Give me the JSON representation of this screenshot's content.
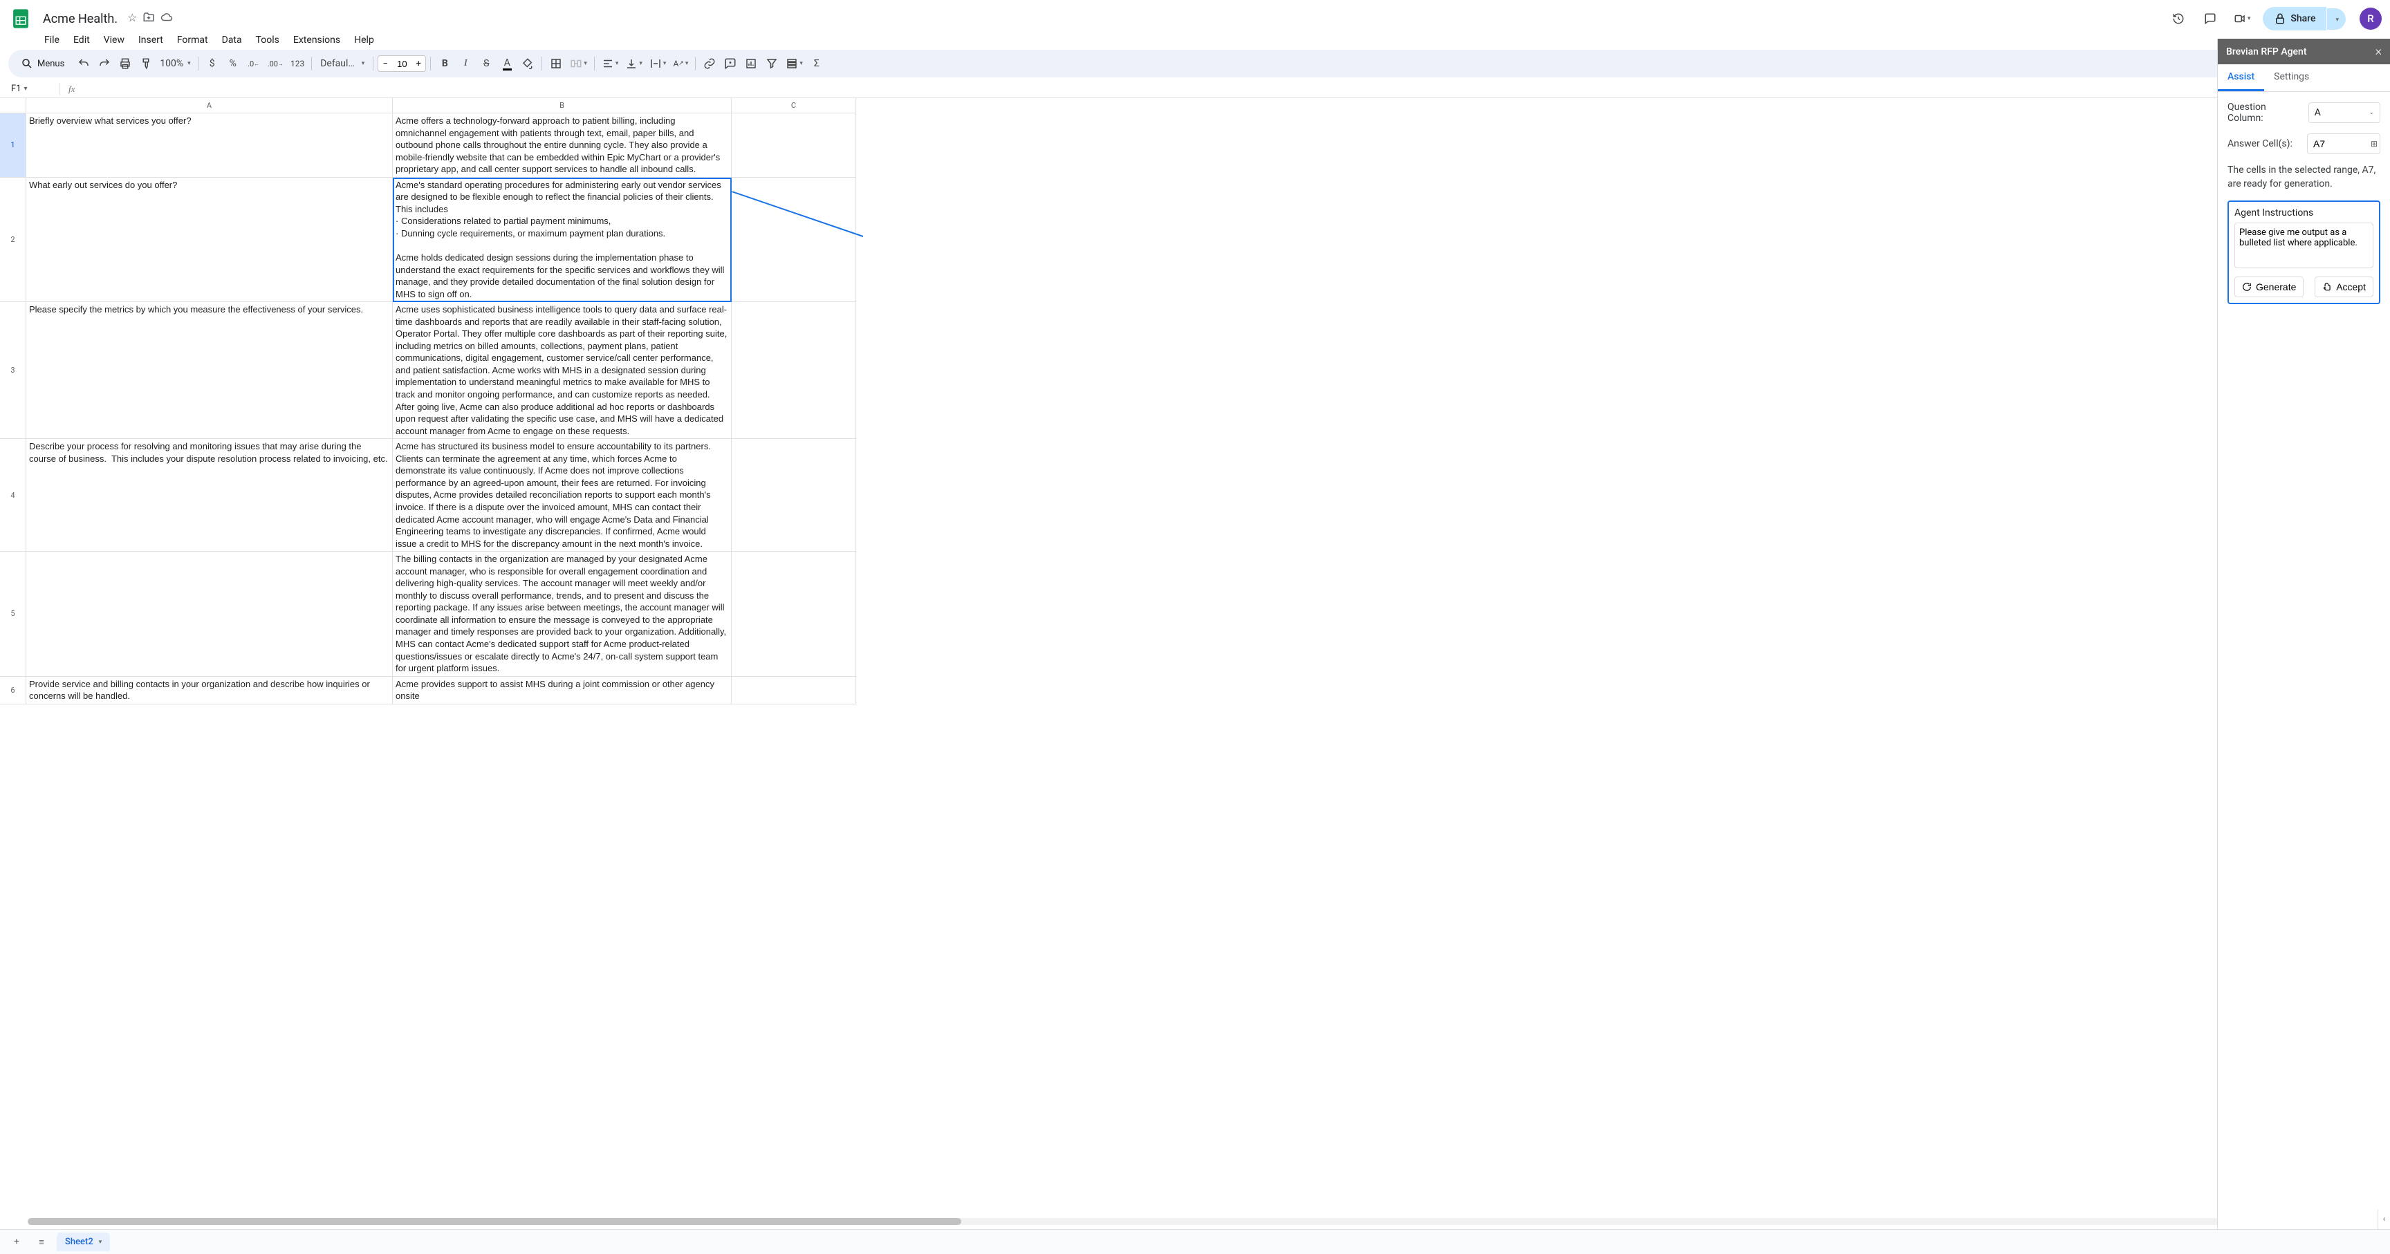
{
  "doc": {
    "title": "Acme Health."
  },
  "menu": [
    "File",
    "Edit",
    "View",
    "Insert",
    "Format",
    "Data",
    "Tools",
    "Extensions",
    "Help"
  ],
  "toolbar": {
    "search_label": "Menus",
    "zoom": "100%",
    "currency": "$",
    "percent": "%",
    "number_fmt": "123",
    "font": "Defaul…",
    "font_size": "10"
  },
  "namebox": "F1",
  "share_label": "Share",
  "avatar_letter": "R",
  "columns": [
    "A",
    "B",
    "C"
  ],
  "rows": [
    {
      "n": "1",
      "a": "Briefly overview what services you offer?",
      "b": "Acme offers a technology-forward approach to patient billing, including omnichannel engagement with patients through text, email, paper bills, and outbound phone calls throughout the entire dunning cycle. They also provide a mobile-friendly website that can be embedded within Epic MyChart or a provider's proprietary app, and call center support services to handle all inbound calls.",
      "c": ""
    },
    {
      "n": "2",
      "a": "What early out services do you offer?",
      "b": "Acme's standard operating procedures for administering early out vendor services are designed to be flexible enough to reflect the financial policies of their clients. This includes\n· Considerations related to partial payment minimums,\n· Dunning cycle requirements, or maximum payment plan durations.\n\nAcme holds dedicated design sessions during the implementation phase to understand the exact requirements for the specific services and workflows they will manage, and they provide detailed documentation of the final solution design for MHS to sign off on.",
      "c": ""
    },
    {
      "n": "3",
      "a": "Please specify the metrics by which you measure the effectiveness of your services.",
      "b": "Acme uses sophisticated business intelligence tools to query data and surface real-time dashboards and reports that are readily available in their staff-facing solution, Operator Portal. They offer multiple core dashboards as part of their reporting suite, including metrics on billed amounts, collections, payment plans, patient communications, digital engagement, customer service/call center performance, and patient satisfaction. Acme works with MHS in a designated session during implementation to understand meaningful metrics to make available for MHS to track and monitor ongoing performance, and can customize reports as needed. After going live, Acme can also produce additional ad hoc reports or dashboards upon request after validating the specific use case, and MHS will have a dedicated account manager from Acme to engage on these requests.",
      "c": ""
    },
    {
      "n": "4",
      "a": "Describe your process for resolving and monitoring issues that may arise during the course of business.  This includes your dispute resolution process related to invoicing, etc.",
      "b": "Acme has structured its business model to ensure accountability to its partners. Clients can terminate the agreement at any time, which forces Acme to demonstrate its value continuously. If Acme does not improve collections performance by an agreed-upon amount, their fees are returned. For invoicing disputes, Acme provides detailed reconciliation reports to support each month's invoice. If there is a dispute over the invoiced amount, MHS can contact their dedicated Acme account manager, who will engage Acme's Data and Financial Engineering teams to investigate any discrepancies. If confirmed, Acme would issue a credit to MHS for the discrepancy amount in the next month's invoice.",
      "c": ""
    },
    {
      "n": "5",
      "a": "",
      "b": "The billing contacts in the organization are managed by your designated Acme account manager, who is responsible for overall engagement coordination and delivering high-quality services. The account manager will meet weekly and/or monthly to discuss overall performance, trends, and to present and discuss the reporting package. If any issues arise between meetings, the account manager will coordinate all information to ensure the message is conveyed to the appropriate manager and timely responses are provided back to your organization. Additionally, MHS can contact Acme's dedicated support staff for Acme product-related questions/issues or escalate directly to Acme's 24/7, on-call system support team for urgent platform issues.",
      "c": ""
    },
    {
      "n": "6",
      "a": "Provide service and billing contacts in your organization and describe how inquiries or concerns will be handled.",
      "b": "Acme provides support to assist MHS during a joint commission or other agency onsite",
      "c": ""
    }
  ],
  "sheet_tab": "Sheet2",
  "agent": {
    "title": "Brevian RFP Agent",
    "tabs": {
      "assist": "Assist",
      "settings": "Settings"
    },
    "qcol_label": "Question Column:",
    "qcol_value": "A",
    "acell_label": "Answer Cell(s):",
    "acell_value": "A7",
    "status": "The cells in the selected range, A7, are ready for generation.",
    "instr_label": "Agent Instructions",
    "instr_value": "Please give me output as a bulleted list where applicable.",
    "generate": "Generate",
    "accept": "Accept"
  }
}
